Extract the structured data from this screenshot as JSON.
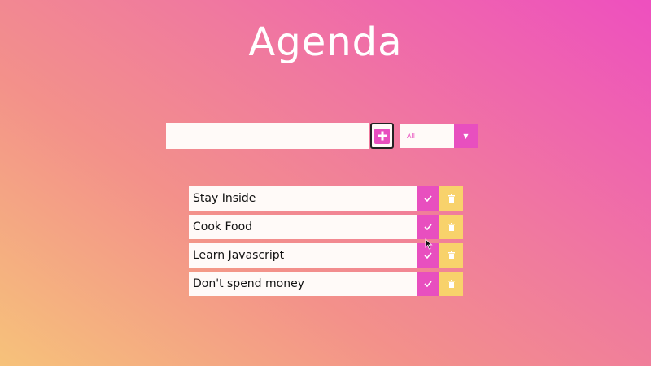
{
  "app": {
    "title": "Agenda"
  },
  "add_form": {
    "input_value": "",
    "input_placeholder": "",
    "add_icon": "plus-square-icon"
  },
  "filter": {
    "selected": "All",
    "arrow_glyph": "▼"
  },
  "todos": [
    {
      "text": "Stay Inside"
    },
    {
      "text": "Cook Food"
    },
    {
      "text": "Learn Javascript"
    },
    {
      "text": "Don't spend money"
    }
  ],
  "colors": {
    "accent": "#e84fbf",
    "trash": "#f8d26b",
    "surface": "#fffaf8"
  }
}
